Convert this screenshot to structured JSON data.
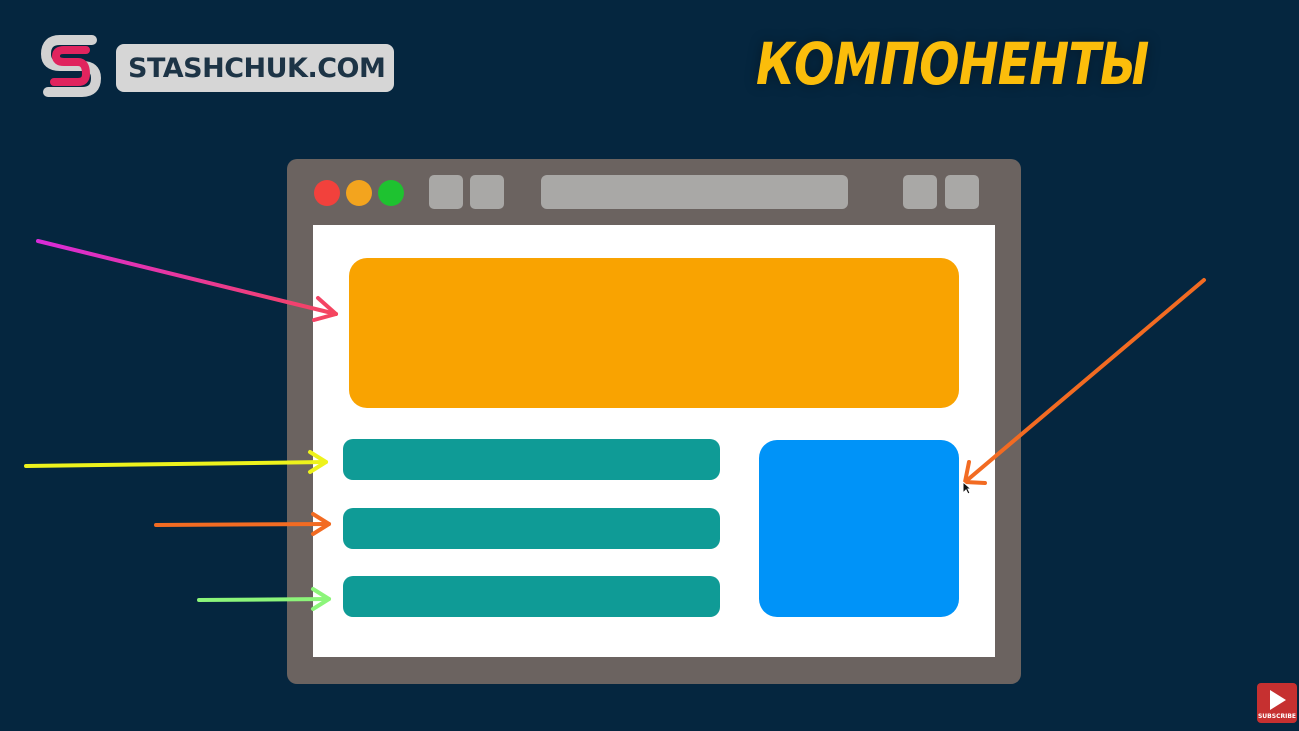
{
  "brand": {
    "logo_text": "STASHCHUK.COM",
    "accent_color": "#e0245e"
  },
  "title": "КОМПОНЕНТЫ",
  "colors": {
    "background": "#05263f",
    "title": "#fbbd0b",
    "header_block": "#f9a301",
    "row_block": "#0f9b96",
    "side_block": "#0093f8",
    "browser_frame": "#6b6360"
  },
  "browser": {
    "window_controls": [
      "close-dot",
      "minimize-dot",
      "maximize-dot"
    ]
  },
  "arrows": [
    {
      "target": "header-block",
      "color": "#f0356f"
    },
    {
      "target": "row-1",
      "color": "#eef21c"
    },
    {
      "target": "row-2",
      "color": "#f26b22"
    },
    {
      "target": "row-3",
      "color": "#8cf57a"
    },
    {
      "target": "side-block",
      "color": "#f26b22"
    }
  ],
  "youtube_badge": {
    "label": "SUBSCRIBE"
  }
}
